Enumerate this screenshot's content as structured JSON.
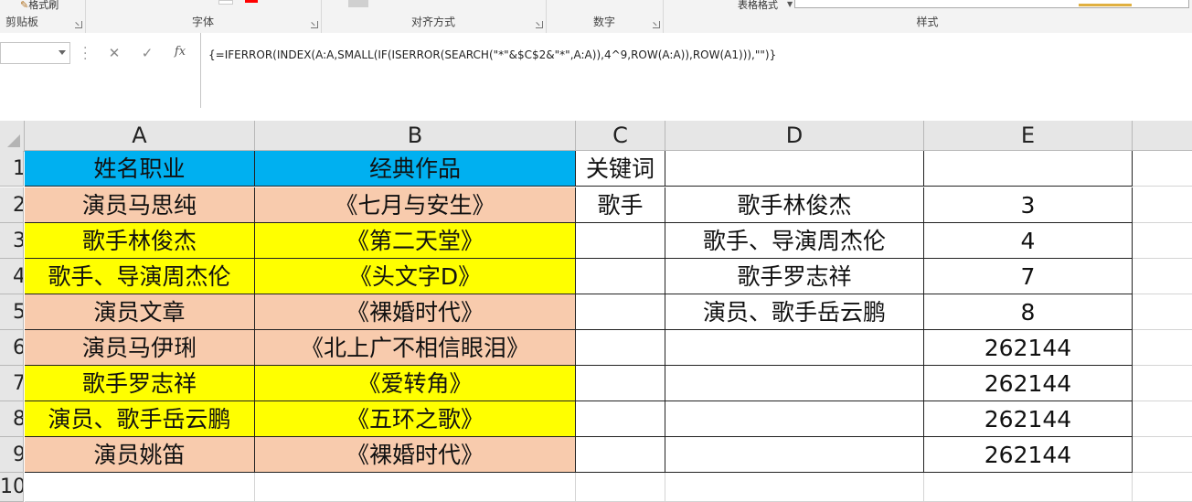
{
  "ribbon": {
    "groups": [
      "剪贴板",
      "字体",
      "对齐方式",
      "数字",
      "样式"
    ],
    "format_painter": "格式刷",
    "table_format": "表格格式"
  },
  "formula_bar": {
    "name_box": "",
    "cancel_icon": "✕",
    "enter_icon": "✓",
    "fx_icon": "fx",
    "formula": "{=IFERROR(INDEX(A:A,SMALL(IF(ISERROR(SEARCH(\"*\"&$C$2&\"*\",A:A)),4^9,ROW(A:A)),ROW(A1))),\"\")}"
  },
  "columns": [
    "A",
    "B",
    "C",
    "D",
    "E"
  ],
  "row_numbers": [
    "1",
    "2",
    "3",
    "4",
    "5",
    "6",
    "7",
    "8",
    "9",
    "10"
  ],
  "colors": {
    "header_blue": "#00b0f0",
    "salmon": "#f8cbad",
    "yellow": "#ffff00"
  },
  "table": {
    "headers": [
      "姓名职业",
      "经典作品"
    ],
    "rows": [
      {
        "a": "演员马思纯",
        "b": "《七月与安生》",
        "fill": "salmon"
      },
      {
        "a": "歌手林俊杰",
        "b": "《第二天堂》",
        "fill": "yellow"
      },
      {
        "a": "歌手、导演周杰伦",
        "b": "《头文字D》",
        "fill": "yellow"
      },
      {
        "a": "演员文章",
        "b": "《裸婚时代》",
        "fill": "salmon"
      },
      {
        "a": "演员马伊琍",
        "b": "《北上广不相信眼泪》",
        "fill": "salmon"
      },
      {
        "a": "歌手罗志祥",
        "b": "《爱转角》",
        "fill": "yellow"
      },
      {
        "a": "演员、歌手岳云鹏",
        "b": "《五环之歌》",
        "fill": "yellow"
      },
      {
        "a": "演员姚笛",
        "b": "《裸婚时代》",
        "fill": "salmon"
      }
    ]
  },
  "keyword": {
    "label": "关键词",
    "value": "歌手"
  },
  "results": [
    "歌手林俊杰",
    "歌手、导演周杰伦",
    "歌手罗志祥",
    "演员、歌手岳云鹏",
    "",
    "",
    "",
    ""
  ],
  "row_indices": [
    "3",
    "4",
    "7",
    "8",
    "262144",
    "262144",
    "262144",
    "262144"
  ]
}
